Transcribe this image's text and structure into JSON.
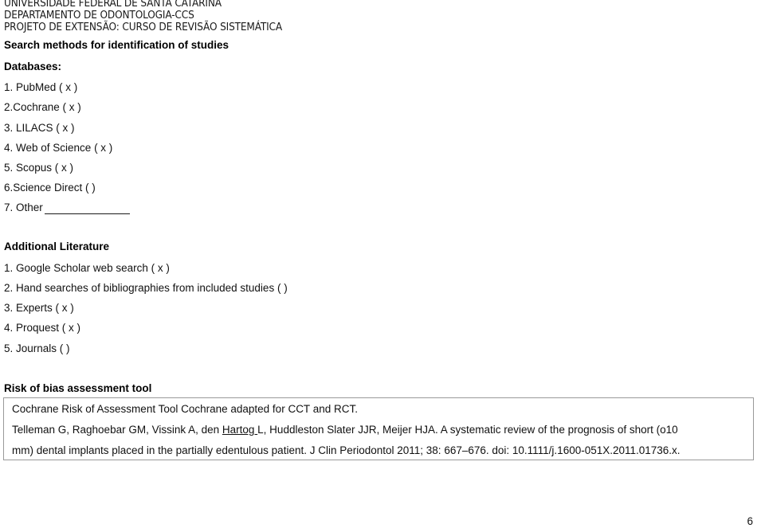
{
  "institution": {
    "line1": "UNIVERSIDADE FEDERAL DE SANTA CATARINA",
    "line2": "DEPARTAMENTO DE ODONTOLOGIA-CCS",
    "line3": "PROJETO DE EXTENSÃO: CURSO DE REVISÃO SISTEMÁTICA"
  },
  "section_search": {
    "title": "Search methods for identification of studies",
    "databases_label": "Databases:",
    "databases": [
      "1. PubMed ( x  )",
      "2.Cochrane ( x  )",
      "3. LILACS (  x )",
      "4. Web of Science ( x  )",
      "5. Scopus ( x )",
      "6.Science Direct (   )",
      "7. Other"
    ]
  },
  "section_additional": {
    "heading": "Additional Literature",
    "items": [
      "1. Google Scholar web search ( x )",
      "2. Hand searches of bibliographies from included studies (  )",
      "3. Experts (  x )",
      "4. Proquest ( x  )",
      "5. Journals (   )"
    ]
  },
  "section_risk": {
    "heading": "Risk of bias assessment tool",
    "citation": {
      "line1": "Cochrane Risk of Assessment Tool Cochrane adapted for CCT and RCT.",
      "line2_before": "Telleman G, Raghoebar GM, Vissink A, den ",
      "line2_underlined": "Hartog ",
      "line2_after": "L, Huddleston Slater JJR, Meijer HJA. A systematic review of the prognosis of short (o10",
      "line3": "mm) dental implants placed in the partially edentulous patient. J Clin Periodontol 2011; 38: 667–676. doi: 10.1111/j.1600-051X.2011.01736.x."
    }
  },
  "footer": {
    "page_number": "6"
  }
}
